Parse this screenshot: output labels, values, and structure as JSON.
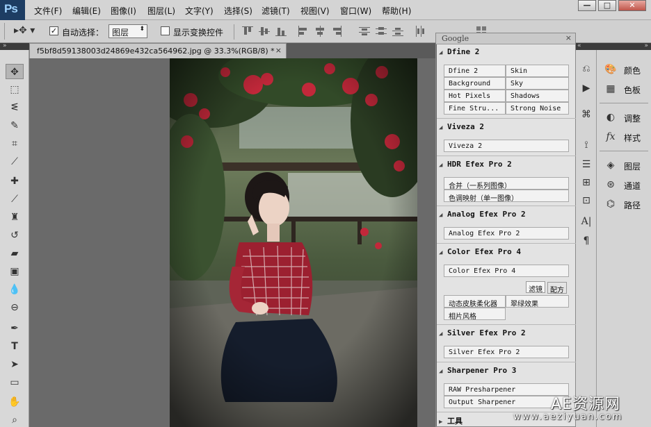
{
  "app": {
    "logo": "Ps"
  },
  "menu": [
    "文件(F)",
    "编辑(E)",
    "图像(I)",
    "图层(L)",
    "文字(Y)",
    "选择(S)",
    "滤镜(T)",
    "视图(V)",
    "窗口(W)",
    "帮助(H)"
  ],
  "window_controls": {
    "minimize": "—",
    "maximize": "□",
    "close": "✕"
  },
  "options": {
    "auto_select_checked": true,
    "auto_select_label": "自动选择：",
    "auto_select_value": "图层",
    "show_transform_checked": false,
    "show_transform_label": "显示变换控件"
  },
  "document": {
    "tab_title": "f5bf8d59138003d24869e432ca564962.jpg @ 33.3%(RGB/8) *",
    "close": "×"
  },
  "tools": [
    "move-tool",
    "marquee-tool",
    "lasso-tool",
    "quick-select-tool",
    "crop-tool",
    "eyedropper-tool",
    "healing-tool",
    "brush-tool",
    "stamp-tool",
    "history-brush-tool",
    "eraser-tool",
    "gradient-tool",
    "blur-tool",
    "dodge-tool",
    "pen-tool",
    "type-tool",
    "path-select-tool",
    "shape-tool",
    "hand-tool",
    "zoom-tool"
  ],
  "google_panel": {
    "title": "Google",
    "close": "×",
    "sections": {
      "dfine": {
        "title": "Dfine 2",
        "buttons": [
          "Dfine 2",
          "Skin",
          "Background",
          "Sky",
          "Hot Pixels",
          "Shadows",
          "Fine Stru...",
          "Strong Noise"
        ]
      },
      "viveza": {
        "title": "Viveza 2",
        "buttons": [
          "Viveza 2"
        ]
      },
      "hdr": {
        "title": "HDR Efex Pro 2",
        "buttons": [
          "合并（一系列图像）",
          "色调映射（单一图像）"
        ]
      },
      "analog": {
        "title": "Analog Efex Pro 2",
        "buttons": [
          "Analog Efex Pro 2"
        ]
      },
      "color": {
        "title": "Color Efex Pro 4",
        "buttons": [
          "Color Efex Pro 4"
        ],
        "tabs": [
          "滤镜",
          "配方"
        ],
        "presets": [
          "动态皮肤柔化器",
          "翠绿效果",
          "相片风格"
        ]
      },
      "silver": {
        "title": "Silver Efex Pro 2",
        "buttons": [
          "Silver Efex Pro 2"
        ]
      },
      "sharpener": {
        "title": "Sharpener Pro 3",
        "buttons": [
          "RAW Presharpener",
          "Output Sharpener"
        ]
      },
      "tools": {
        "title": "工具"
      }
    }
  },
  "right_panels": [
    {
      "label": "颜色",
      "icon": "palette-icon"
    },
    {
      "label": "色板",
      "icon": "swatches-icon"
    },
    {
      "label": "调整",
      "icon": "adjustments-icon"
    },
    {
      "label": "样式",
      "icon": "styles-icon"
    },
    {
      "label": "图层",
      "icon": "layers-icon"
    },
    {
      "label": "通道",
      "icon": "channels-icon"
    },
    {
      "label": "路径",
      "icon": "paths-icon"
    }
  ],
  "watermark": {
    "brand": "AE资源网",
    "url": "www.aeziyuan.com"
  }
}
